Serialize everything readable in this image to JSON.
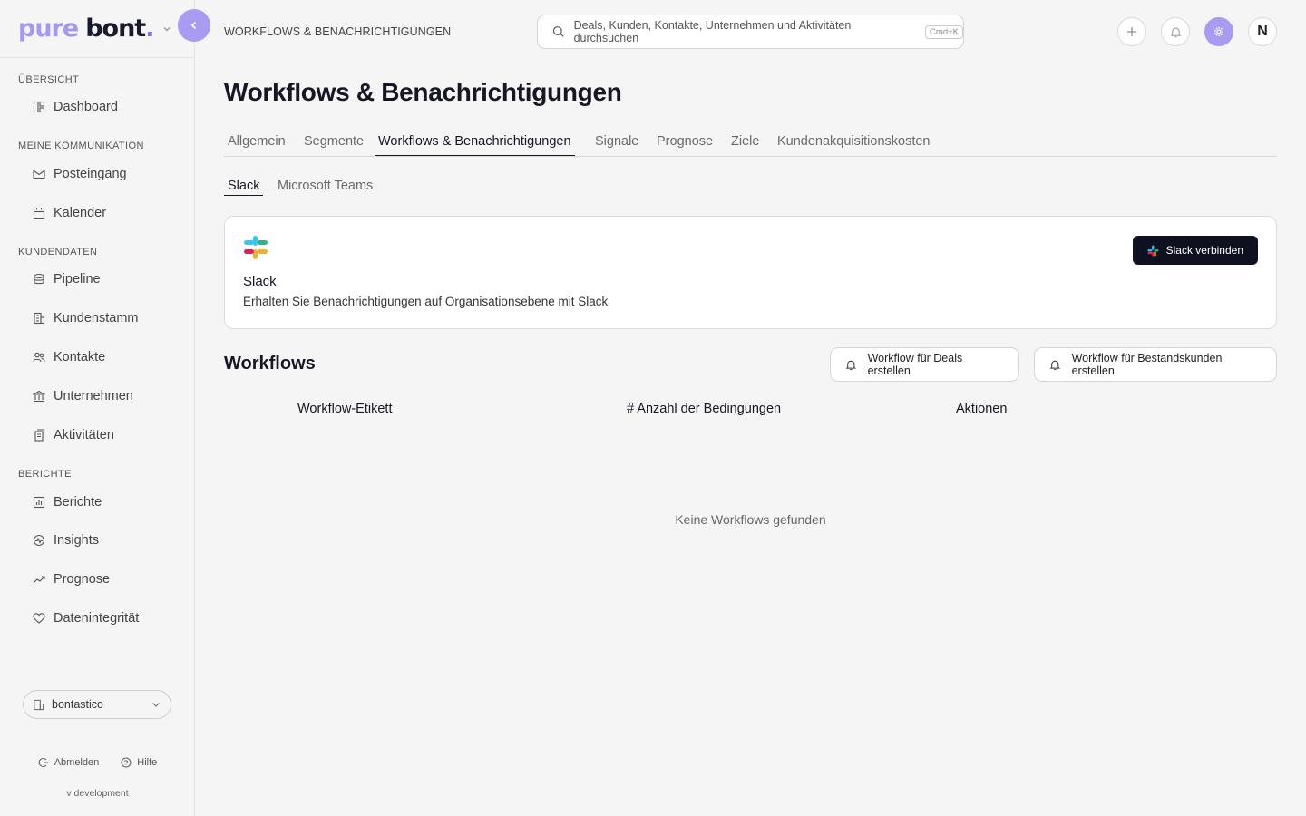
{
  "brand": {
    "part1": "pure",
    "part2": "bont",
    "dot": "."
  },
  "sidebar": {
    "sections": [
      {
        "title": "ÜBERSICHT"
      },
      {
        "title": "MEINE KOMMUNIKATION"
      },
      {
        "title": "KUNDENDATEN"
      },
      {
        "title": "BERICHTE"
      }
    ],
    "items": [
      {
        "label": "Dashboard",
        "icon": "layout-icon"
      },
      {
        "label": "Posteingang",
        "icon": "mail-icon"
      },
      {
        "label": "Kalender",
        "icon": "calendar-icon"
      },
      {
        "label": "Pipeline",
        "icon": "database-icon"
      },
      {
        "label": "Kundenstamm",
        "icon": "building-icon"
      },
      {
        "label": "Kontakte",
        "icon": "users-icon"
      },
      {
        "label": "Unternehmen",
        "icon": "bank-icon"
      },
      {
        "label": "Aktivitäten",
        "icon": "files-icon"
      },
      {
        "label": "Berichte",
        "icon": "bar-chart-icon"
      },
      {
        "label": "Insights",
        "icon": "activity-icon"
      },
      {
        "label": "Prognose",
        "icon": "trend-icon"
      },
      {
        "label": "Datenintegrität",
        "icon": "heart-icon"
      }
    ],
    "org": "bontastico",
    "logout": "Abmelden",
    "help": "Hilfe",
    "version": "v development"
  },
  "header": {
    "breadcrumb": "WORKFLOWS & BENACHRICHTIGUNGEN",
    "search_placeholder": "Deals, Kunden, Kontakte, Unternehmen und Aktivitäten durchsuchen",
    "shortcut": "Cmd+K",
    "avatar_initial": "N"
  },
  "main": {
    "title": "Workflows & Benachrichtigungen",
    "tabs": [
      "Allgemein",
      "Segmente",
      "Workflows & Benachrichtigungen",
      "Signale",
      "Prognose",
      "Ziele",
      "Kundenakquisitionskosten"
    ],
    "active_tab": "Workflows & Benachrichtigungen",
    "subtabs": [
      "Slack",
      "Microsoft Teams"
    ],
    "active_subtab": "Slack",
    "slack_card": {
      "title": "Slack",
      "description": "Erhalten Sie Benachrichtigungen auf Organisationsebene mit Slack",
      "connect_label": "Slack verbinden"
    },
    "workflows": {
      "title": "Workflows",
      "btn_deals": "Workflow für Deals erstellen",
      "btn_customers": "Workflow für Bestandskunden erstellen",
      "columns": [
        "Workflow-Etikett",
        "# Anzahl der Bedingungen",
        "Aktionen"
      ],
      "empty": "Keine Workflows gefunden"
    }
  },
  "colors": {
    "accent": "#a99af2",
    "dark": "#0f1020"
  }
}
